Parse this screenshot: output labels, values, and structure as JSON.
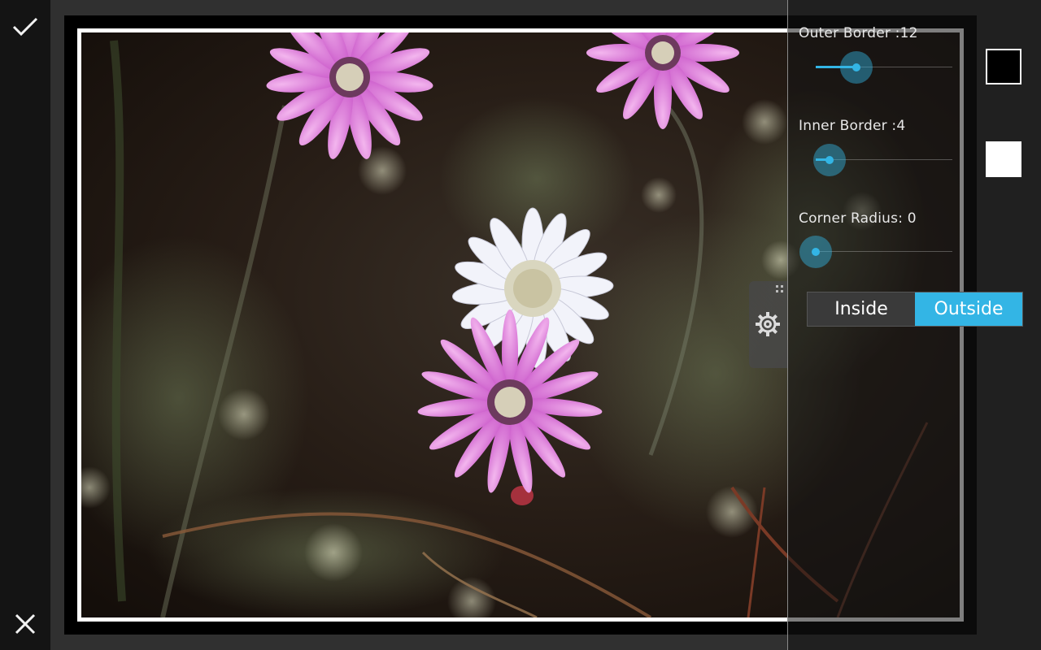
{
  "toolbar": {
    "confirm_icon": "checkmark-icon",
    "cancel_icon": "close-icon"
  },
  "settings": {
    "outer_border": {
      "label": "Outer Border :12",
      "value": 12,
      "fraction": 0.3,
      "color": "#000000"
    },
    "inner_border": {
      "label": "Inner Border :4",
      "value": 4,
      "fraction": 0.1,
      "color": "#ffffff"
    },
    "corner_radius": {
      "label": "Corner Radius:  0",
      "value": 0,
      "fraction": 0.0
    },
    "position": {
      "inside_label": "Inside",
      "outside_label": "Outside",
      "selected": "outside"
    },
    "handle_icon": "gear-icon"
  },
  "colors": {
    "accent": "#33b5e5",
    "toggle_inactive": "#3a3a3a",
    "frame_outer": "#000000",
    "frame_inner": "#ffffff"
  }
}
